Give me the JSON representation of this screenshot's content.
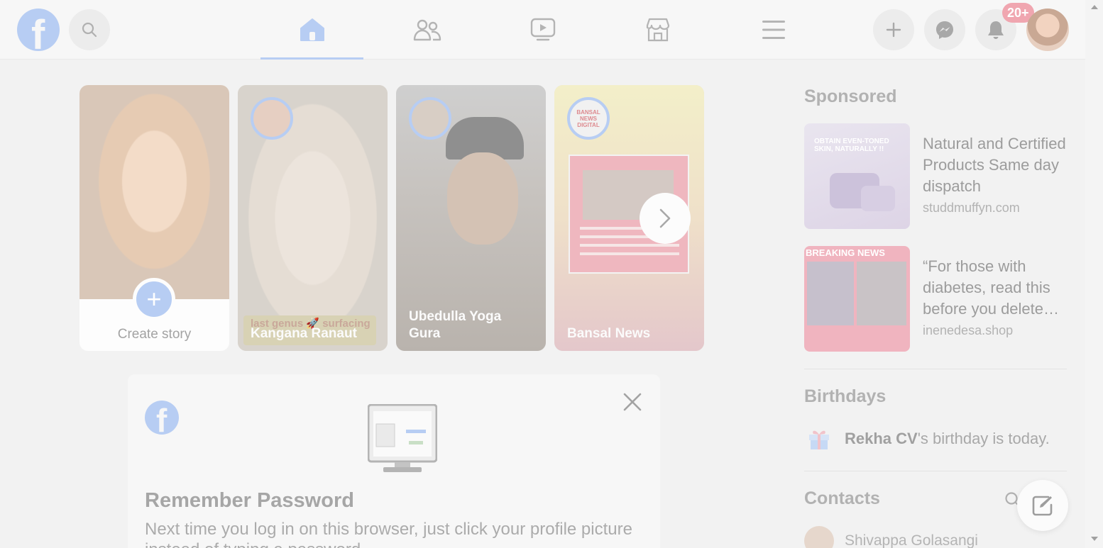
{
  "topbar": {
    "logo_letter": "f",
    "notifications_badge": "20+",
    "nav_tabs": [
      {
        "name": "home",
        "active": true
      },
      {
        "name": "friends",
        "active": false
      },
      {
        "name": "video",
        "active": false
      },
      {
        "name": "marketplace",
        "active": false
      },
      {
        "name": "menu",
        "active": false
      }
    ],
    "right_buttons": [
      "plus-icon",
      "messenger-icon",
      "bell-icon",
      "profile-avatar"
    ]
  },
  "stories": {
    "create_label": "Create story",
    "items": [
      {
        "name": "Kangana Ranaut",
        "overlay_text": "last genus 🚀 surfacing"
      },
      {
        "name": "Ubedulla Yoga Gura"
      },
      {
        "name": "Bansal News",
        "logo_text": "BANSAL NEWS DIGITAL"
      }
    ]
  },
  "remember_password": {
    "logo_letter": "f",
    "title": "Remember Password",
    "text": "Next time you log in on this browser, just click your profile picture instead of typing a password."
  },
  "sponsored": {
    "title": "Sponsored",
    "ads": [
      {
        "title": "Natural and Certified Products Same day dispatch",
        "domain": "studdmuffyn.com",
        "thumb_text": "OBTAIN EVEN-TONED SKIN, NATURALLY !!"
      },
      {
        "title": "“For those with diabetes, read this before you delete…",
        "domain": "inenedesa.shop",
        "thumb_text": "BREAKING NEWS"
      }
    ]
  },
  "birthdays": {
    "title": "Birthdays",
    "person": "Rekha CV",
    "suffix": "'s birthday is today."
  },
  "contacts": {
    "title": "Contacts",
    "items": [
      "Shivappa Golasangi"
    ]
  },
  "colors": {
    "accent": "#b7cdf3",
    "badge": "#f0a6b0",
    "background": "#f2f2f2"
  }
}
